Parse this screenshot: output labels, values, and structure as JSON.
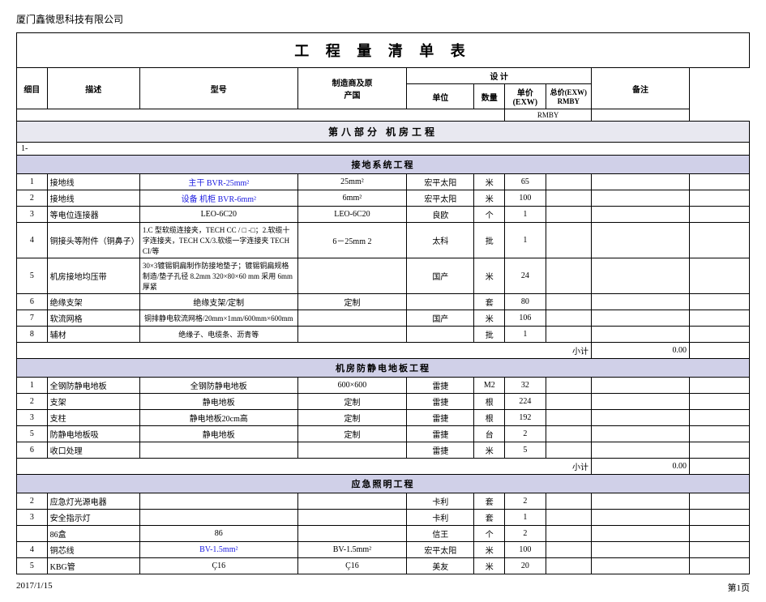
{
  "company": "厦门鑫微思科技有限公司",
  "title": "工  程  量  清  单  表",
  "headers": {
    "col1": "细目",
    "col2": "描述",
    "col3": "型号",
    "col4_line1": "制造商及原",
    "col4_line2": "产国",
    "col5": "单位",
    "col6": "数量",
    "col7_line1": "单价",
    "col7_line2": "(EXW)",
    "col8_line1": "总价(EXW) RMBY",
    "col8_line2": "RMBY",
    "col9": "备注",
    "design": "设  计"
  },
  "section1": {
    "label": "第八部分   机房工程",
    "subsection1": {
      "label": "接地系统工程",
      "prefix": "1-",
      "rows": [
        {
          "no": "1",
          "name": "接地线",
          "desc": "主干  BVR-25mm²",
          "model": "25mm²",
          "maker": "宏平太阳",
          "unit": "米",
          "qty": "65",
          "uprice": "",
          "total": "",
          "note": ""
        },
        {
          "no": "2",
          "name": "接地线",
          "desc": "设备 机柜  BVR-6mm²",
          "model": "6mm²",
          "maker": "宏平太阳",
          "unit": "米",
          "qty": "100",
          "uprice": "",
          "total": "",
          "note": ""
        },
        {
          "no": "3",
          "name": "等电位连接器",
          "desc": "LEO-6C20",
          "model": "LEO-6C20",
          "maker": "良欧",
          "unit": "个",
          "qty": "1",
          "uprice": "",
          "total": "",
          "note": ""
        },
        {
          "no": "4",
          "name": "铜接头等附件（铜鼻子）",
          "desc": "1.C 型软缆连接夹，TECH CC / □ -□；2.软缆十字连接夹，TECH CX/3.软缆一字连接夹 TECH CI/等",
          "model": "6－25mm 2",
          "maker": "太科",
          "unit": "批",
          "qty": "1",
          "uprice": "",
          "total": "",
          "note": ""
        },
        {
          "no": "5",
          "name": "机房接地均压带",
          "desc": "30×3镀锡铜扁制作防接地垫子；镀锡铜扁规格制造/垫子孔径  8.2mm  320×80×60 mm  采用 6mm 厚紧",
          "model": "",
          "maker": "国产",
          "unit": "米",
          "qty": "24",
          "uprice": "",
          "total": "",
          "note": ""
        },
        {
          "no": "6",
          "name": "绝缘支架",
          "desc": "绝缘支架/定制",
          "model": "定制",
          "maker": "",
          "unit": "套",
          "qty": "80",
          "uprice": "",
          "total": "",
          "note": ""
        },
        {
          "no": "7",
          "name": "软流网格",
          "desc": "铜排静电软流网格/20mm×1mm/600mm×600mm",
          "model": "",
          "maker": "国产",
          "unit": "米",
          "qty": "106",
          "uprice": "",
          "total": "",
          "note": ""
        },
        {
          "no": "8",
          "name": "辅材",
          "desc": "绝缘子、电缆条、沥青等",
          "model": "",
          "maker": "",
          "unit": "批",
          "qty": "1",
          "uprice": "",
          "total": "",
          "note": ""
        }
      ],
      "subtotal_label": "小计",
      "subtotal_value": "0.00"
    },
    "subsection2": {
      "label": "机房防静电地板工程",
      "rows": [
        {
          "no": "1",
          "name": "全钢防静电地板",
          "desc": "全钢防静电地板",
          "model": "600×600",
          "maker": "雷捷",
          "unit": "M2",
          "qty": "32",
          "uprice": "",
          "total": "",
          "note": ""
        },
        {
          "no": "2",
          "name": "支架",
          "desc": "静电地板",
          "model": "定制",
          "maker": "雷捷",
          "unit": "根",
          "qty": "224",
          "uprice": "",
          "total": "",
          "note": ""
        },
        {
          "no": "3",
          "name": "支柱",
          "desc": "静电地板20cm高",
          "model": "定制",
          "maker": "雷捷",
          "unit": "根",
          "qty": "192",
          "uprice": "",
          "total": "",
          "note": ""
        },
        {
          "no": "5",
          "name": "防静电地板吸",
          "desc": "静电地板",
          "model": "定制",
          "maker": "雷捷",
          "unit": "台",
          "qty": "2",
          "uprice": "",
          "total": "",
          "note": ""
        },
        {
          "no": "6",
          "name": "收口处理",
          "desc": "",
          "model": "",
          "maker": "雷捷",
          "unit": "米",
          "qty": "5",
          "uprice": "",
          "total": "",
          "note": ""
        }
      ],
      "subtotal_label": "小计",
      "subtotal_value": "0.00"
    },
    "subsection3": {
      "label": "应急照明工程",
      "rows": [
        {
          "no": "2",
          "name": "应急灯光源电器",
          "desc": "",
          "model": "",
          "maker": "卡利",
          "unit": "套",
          "qty": "2",
          "uprice": "",
          "total": "",
          "note": ""
        },
        {
          "no": "3",
          "name": "安全指示灯",
          "desc": "",
          "model": "",
          "maker": "卡利",
          "unit": "套",
          "qty": "1",
          "uprice": "",
          "total": "",
          "note": ""
        },
        {
          "no": "",
          "name": "86盒",
          "desc": "86",
          "model": "",
          "maker": "信王",
          "unit": "个",
          "qty": "2",
          "uprice": "",
          "total": "",
          "note": ""
        },
        {
          "no": "4",
          "name": "铜芯线",
          "desc": "BV-1.5mm²",
          "model": "BV-1.5mm²",
          "maker": "宏平太阳",
          "unit": "米",
          "qty": "100",
          "uprice": "",
          "total": "",
          "note": ""
        },
        {
          "no": "5",
          "name": "KBG管",
          "desc": "Ç16",
          "model": "Ç16",
          "maker": "美友",
          "unit": "米",
          "qty": "20",
          "uprice": "",
          "total": "",
          "note": ""
        }
      ]
    }
  },
  "footer": {
    "date": "2017/1/15",
    "page": "第1页"
  }
}
